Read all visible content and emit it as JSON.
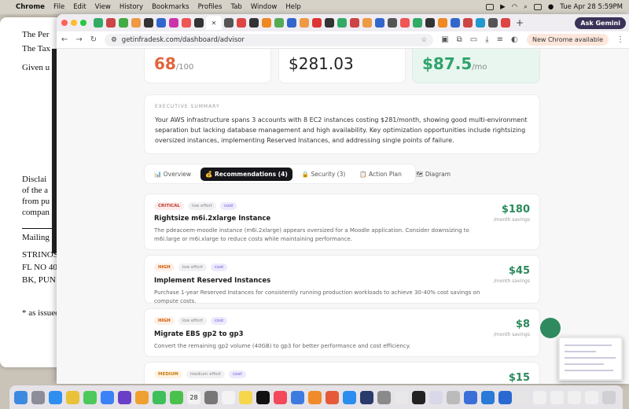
{
  "menubar": {
    "app": "Chrome",
    "items": [
      "File",
      "Edit",
      "View",
      "History",
      "Bookmarks",
      "Profiles",
      "Tab",
      "Window",
      "Help"
    ],
    "datetime": "Tue Apr 28  5:59PM"
  },
  "background_doc": {
    "lines": [
      "The Per",
      "The Tax",
      "Given u",
      "Disclai",
      "of the a",
      "from pu",
      "compan",
      "Mailing",
      "STRINOS",
      "FL NO 40",
      "BK, PUN",
      "* as issued"
    ]
  },
  "browser": {
    "ask_label": "Ask Gemini",
    "url": "getinfradesk.com/dashboard/advisor",
    "update_label": "New Chrome available"
  },
  "metrics": {
    "score": {
      "value": "68",
      "suffix": "/100"
    },
    "cost": {
      "value": "$281.03"
    },
    "savings": {
      "value": "$87.5",
      "suffix": "/mo"
    }
  },
  "summary": {
    "label": "EXECUTIVE SUMMARY",
    "text": "Your AWS infrastructure spans 3 accounts with 8 EC2 instances costing $281/month, showing good multi-environment separation but lacking database management and high availability. Key optimization opportunities include rightsizing oversized instances, implementing Reserved Instances, and addressing single points of failure."
  },
  "tabs": [
    {
      "icon": "📊",
      "label": "Overview"
    },
    {
      "icon": "💰",
      "label": "Recommendations (4)"
    },
    {
      "icon": "🔒",
      "label": "Security (3)"
    },
    {
      "icon": "📋",
      "label": "Action Plan"
    },
    {
      "icon": "🗺",
      "label": "Diagram"
    }
  ],
  "recommendations": [
    {
      "priority": "CRITICAL",
      "effort": "low effort",
      "category": "cost",
      "title": "Rightsize m6i.2xlarge Instance",
      "description": "The pdeacoem-moodle instance (m6i.2xlarge) appears oversized for a Moodle application. Consider downsizing to m6i.large or m6i.xlarge to reduce costs while maintaining performance.",
      "amount": "$180",
      "per": "/month savings"
    },
    {
      "priority": "HIGH",
      "effort": "low effort",
      "category": "cost",
      "title": "Implement Reserved Instances",
      "description": "Purchase 1-year Reserved Instances for consistently running production workloads to achieve 30-40% cost savings on compute costs.",
      "amount": "$45",
      "per": "/month savings"
    },
    {
      "priority": "HIGH",
      "effort": "low effort",
      "category": "cost",
      "title": "Migrate EBS gp2 to gp3",
      "description": "Convert the remaining gp2 volume (40GB) to gp3 for better performance and cost efficiency.",
      "amount": "$8",
      "per": "/month savings"
    },
    {
      "priority": "MEDIUM",
      "effort": "medium effort",
      "category": "cost",
      "title": "",
      "description": "",
      "amount": "$15",
      "per": ""
    }
  ],
  "dock": {
    "calendar_day": "28"
  }
}
